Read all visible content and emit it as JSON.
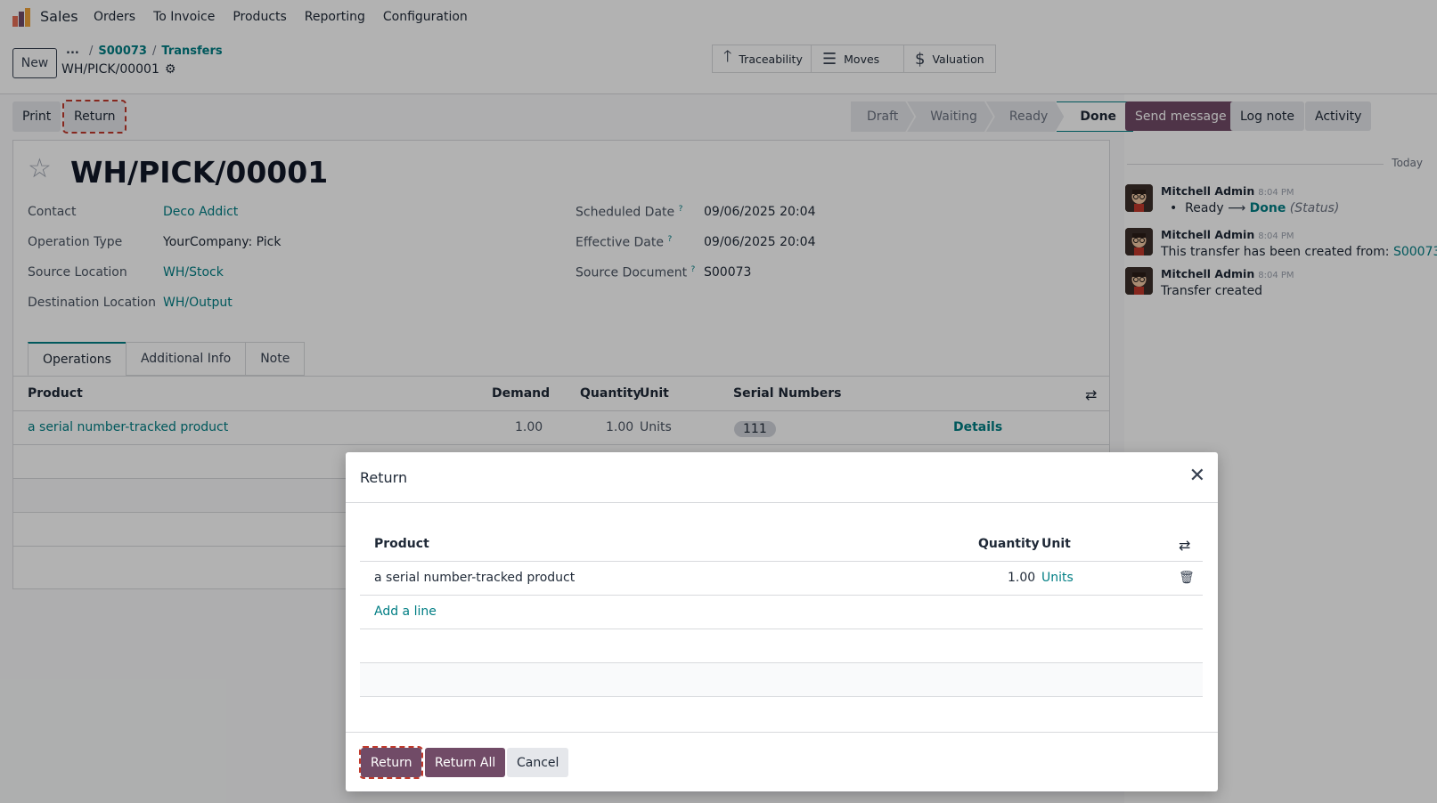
{
  "nav": {
    "app_name": "Sales",
    "menu": [
      "Orders",
      "To Invoice",
      "Products",
      "Reporting",
      "Configuration"
    ]
  },
  "control_panel": {
    "new_label": "New",
    "breadcrumb_dots": "...",
    "breadcrumb": [
      "S00073",
      "Transfers"
    ],
    "record_name": "WH/PICK/00001",
    "smart_buttons": [
      {
        "icon": "arrow-up-icon",
        "label": "Traceability"
      },
      {
        "icon": "list-icon",
        "label": "Moves"
      },
      {
        "icon": "dollar-icon",
        "label": "Valuation"
      }
    ]
  },
  "statusbar": {
    "print_label": "Print",
    "return_label": "Return",
    "stages": [
      "Draft",
      "Waiting",
      "Ready",
      "Done"
    ],
    "active_stage": "Done"
  },
  "form": {
    "title": "WH/PICK/00001",
    "contact_label": "Contact",
    "contact_value": "Deco Addict",
    "operation_type_label": "Operation Type",
    "operation_type_value": "YourCompany: Pick",
    "source_location_label": "Source Location",
    "source_location_value": "WH/Stock",
    "destination_location_label": "Destination Location",
    "destination_location_value": "WH/Output",
    "scheduled_date_label": "Scheduled Date",
    "scheduled_date_value": "09/06/2025 20:04",
    "effective_date_label": "Effective Date",
    "effective_date_value": "09/06/2025 20:04",
    "source_document_label": "Source Document",
    "source_document_value": "S00073",
    "help_mark": "?",
    "tabs": [
      "Operations",
      "Additional Info",
      "Note"
    ],
    "ops_columns": {
      "product": "Product",
      "demand": "Demand",
      "quantity": "Quantity",
      "unit": "Unit",
      "serial": "Serial Numbers"
    },
    "ops_row": {
      "product": "a serial number-tracked product",
      "demand": "1.00",
      "quantity": "1.00",
      "unit": "Units",
      "serial": "111",
      "details": "Details"
    }
  },
  "chatter": {
    "send_message": "Send message",
    "log_note": "Log note",
    "activity": "Activity",
    "today": "Today",
    "messages": [
      {
        "author": "Mitchell Admin",
        "time": "8:04 PM",
        "from": "Ready",
        "to": "Done",
        "field": "(Status)"
      },
      {
        "author": "Mitchell Admin",
        "time": "8:04 PM",
        "text": "This transfer has been created from: ",
        "link": "S00073"
      },
      {
        "author": "Mitchell Admin",
        "time": "8:04 PM",
        "text": "Transfer created"
      }
    ]
  },
  "modal": {
    "title": "Return",
    "columns": {
      "product": "Product",
      "quantity": "Quantity",
      "unit": "Unit"
    },
    "row": {
      "product": "a serial number-tracked product",
      "quantity": "1.00",
      "unit": "Units"
    },
    "add_line": "Add a line",
    "return_label": "Return",
    "return_all_label": "Return All",
    "cancel_label": "Cancel"
  },
  "colors": {
    "primary": "#714b67",
    "link": "#017e84",
    "accent_outline": "#c0392b"
  }
}
